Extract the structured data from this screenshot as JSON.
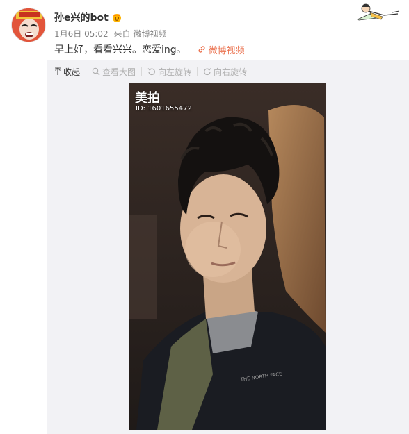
{
  "post": {
    "username": "孙e兴的bot",
    "vip_icon": "crown-badge-icon",
    "time": "1月6日 05:02",
    "source_prefix": "来自",
    "source": "微博视频",
    "text": "早上好，看看兴兴。恋爱ing。",
    "link_icon": "link-icon",
    "link_label": "微博视频"
  },
  "toolbar": {
    "collapse": "收起",
    "view_large": "查看大图",
    "rotate_left": "向左旋转",
    "rotate_right": "向右旋转"
  },
  "video": {
    "watermark_title": "美拍",
    "watermark_id": "ID: 1601655472"
  },
  "colors": {
    "link": "#eb7350",
    "panel_bg": "#f2f2f5",
    "meta_text": "#808080"
  }
}
